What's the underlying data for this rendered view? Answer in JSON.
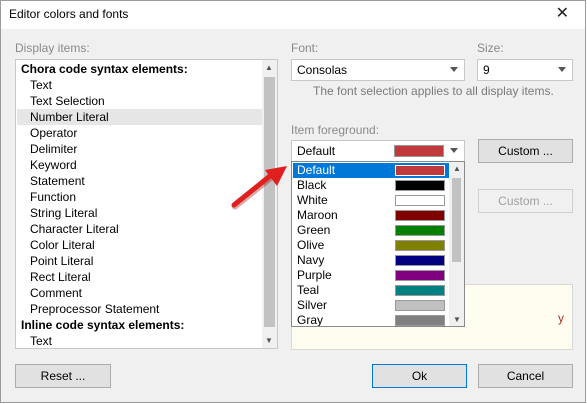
{
  "window": {
    "title": "Editor colors and fonts",
    "close_glyph": "✕"
  },
  "display_items": {
    "label": "Display items:",
    "items": [
      {
        "text": "Chora code syntax elements:",
        "kind": "header"
      },
      {
        "text": "Text",
        "kind": "child"
      },
      {
        "text": "Text Selection",
        "kind": "child"
      },
      {
        "text": "Number Literal",
        "kind": "child",
        "selected": true
      },
      {
        "text": "Operator",
        "kind": "child"
      },
      {
        "text": "Delimiter",
        "kind": "child"
      },
      {
        "text": "Keyword",
        "kind": "child"
      },
      {
        "text": "Statement",
        "kind": "child"
      },
      {
        "text": "Function",
        "kind": "child"
      },
      {
        "text": "String Literal",
        "kind": "child"
      },
      {
        "text": "Character Literal",
        "kind": "child"
      },
      {
        "text": "Color Literal",
        "kind": "child"
      },
      {
        "text": "Point Literal",
        "kind": "child"
      },
      {
        "text": "Rect Literal",
        "kind": "child"
      },
      {
        "text": "Comment",
        "kind": "child"
      },
      {
        "text": "Preprocessor Statement",
        "kind": "child"
      },
      {
        "text": "Inline code syntax elements:",
        "kind": "header"
      },
      {
        "text": "Text",
        "kind": "child"
      }
    ]
  },
  "font": {
    "label": "Font:",
    "value": "Consolas"
  },
  "size": {
    "label": "Size:",
    "value": "9"
  },
  "font_note": "The font selection applies to all display items.",
  "foreground": {
    "label": "Item foreground:",
    "value": "Default",
    "swatch": "#c0393b",
    "custom_label": "Custom ..."
  },
  "background": {
    "custom_label": "Custom ..."
  },
  "color_options": [
    {
      "name": "Default",
      "color": "#c0393b",
      "selected": true
    },
    {
      "name": "Black",
      "color": "#000000"
    },
    {
      "name": "White",
      "color": "#ffffff"
    },
    {
      "name": "Maroon",
      "color": "#800000"
    },
    {
      "name": "Green",
      "color": "#008000"
    },
    {
      "name": "Olive",
      "color": "#808000"
    },
    {
      "name": "Navy",
      "color": "#000080"
    },
    {
      "name": "Purple",
      "color": "#800080"
    },
    {
      "name": "Teal",
      "color": "#008080"
    },
    {
      "name": "Silver",
      "color": "#c0c0c0"
    },
    {
      "name": "Gray",
      "color": "#808080"
    }
  ],
  "preview": {
    "text": "y"
  },
  "buttons": {
    "reset": "Reset ...",
    "ok": "Ok",
    "cancel": "Cancel"
  },
  "colors": {
    "selection_blue": "#0078d7",
    "annotation_red": "#e0201e"
  }
}
